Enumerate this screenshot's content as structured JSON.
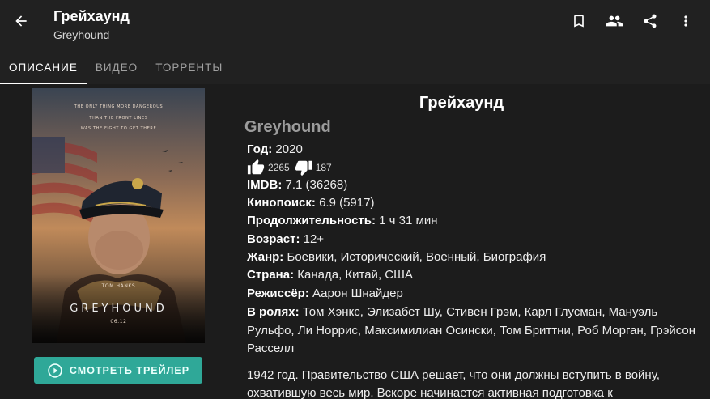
{
  "header": {
    "title": "Грейхаунд",
    "subtitle": "Greyhound",
    "back_icon": "arrow-back-icon",
    "action_icons": [
      "bookmark-icon",
      "people-icon",
      "share-icon",
      "more-vert-icon"
    ]
  },
  "tabs": [
    {
      "label": "ОПИСАНИЕ",
      "active": true
    },
    {
      "label": "ВИДЕО",
      "active": false
    },
    {
      "label": "ТОРРЕНТЫ",
      "active": false
    }
  ],
  "poster": {
    "tagline": [
      "THE ONLY THING MORE DANGEROUS",
      "THAN THE FRONT LINES",
      "WAS THE FIGHT TO GET THERE"
    ],
    "actor": "TOM HANKS",
    "name": "GREYHOUND",
    "date": "06.12"
  },
  "trailer_button": {
    "label": "СМОТРЕТЬ ТРЕЙЛЕР",
    "icon": "play-circle-icon"
  },
  "movie": {
    "title": "Грейхаунд",
    "original_title": "Greyhound",
    "year_label": "Год:",
    "year": "2020",
    "likes": "2265",
    "dislikes": "187",
    "imdb_label": "IMDB:",
    "imdb": "7.1 (36268)",
    "kp_label": "Кинопоиск:",
    "kp": "6.9 (5917)",
    "duration_label": "Продолжительность:",
    "duration": "1 ч 31 мин",
    "age_label": "Возраст:",
    "age": "12+",
    "genre_label": "Жанр:",
    "genre": "Боевики, Исторический, Военный, Биография",
    "country_label": "Страна:",
    "country": "Канада, Китай, США",
    "director_label": "Режиссёр:",
    "director": "Аарон Шнайдер",
    "cast_label": "В ролях:",
    "cast": "Том Хэнкс, Элизабет Шу, Стивен Грэм, Карл Глусман, Мануэль Рульфо, Ли Норрис, Максимилиан Осински, Том Бриттни, Роб Морган, Грэйсон Расселл",
    "description": "1942 год. Правительство США решает, что они должны вступить в войну, охватившую весь мир. Вскоре начинается активная подготовка к"
  },
  "colors": {
    "background": "#1c1c1c",
    "appbar": "#212121",
    "accent": "#2fa898"
  }
}
